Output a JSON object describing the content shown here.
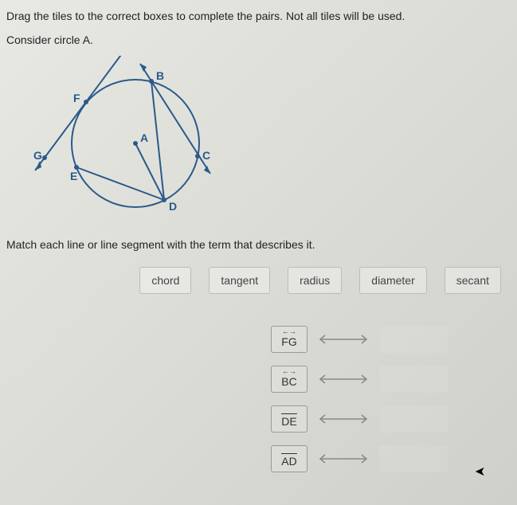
{
  "instruction": "Drag the tiles to the correct boxes to complete the pairs. Not all tiles will be used.",
  "consider": "Consider circle A.",
  "match_text": "Match each line or line segment with the term that describes it.",
  "diagram": {
    "labels": {
      "A": "A",
      "B": "B",
      "C": "C",
      "D": "D",
      "E": "E",
      "F": "F",
      "G": "G"
    }
  },
  "tiles": {
    "chord": "chord",
    "tangent": "tangent",
    "radius": "radius",
    "diameter": "diameter",
    "secant": "secant"
  },
  "pairs": {
    "fg": {
      "label": "FG",
      "type": "line"
    },
    "bc": {
      "label": "BC",
      "type": "line"
    },
    "de": {
      "label": "DE",
      "type": "segment"
    },
    "ad": {
      "label": "AD",
      "type": "segment"
    }
  }
}
